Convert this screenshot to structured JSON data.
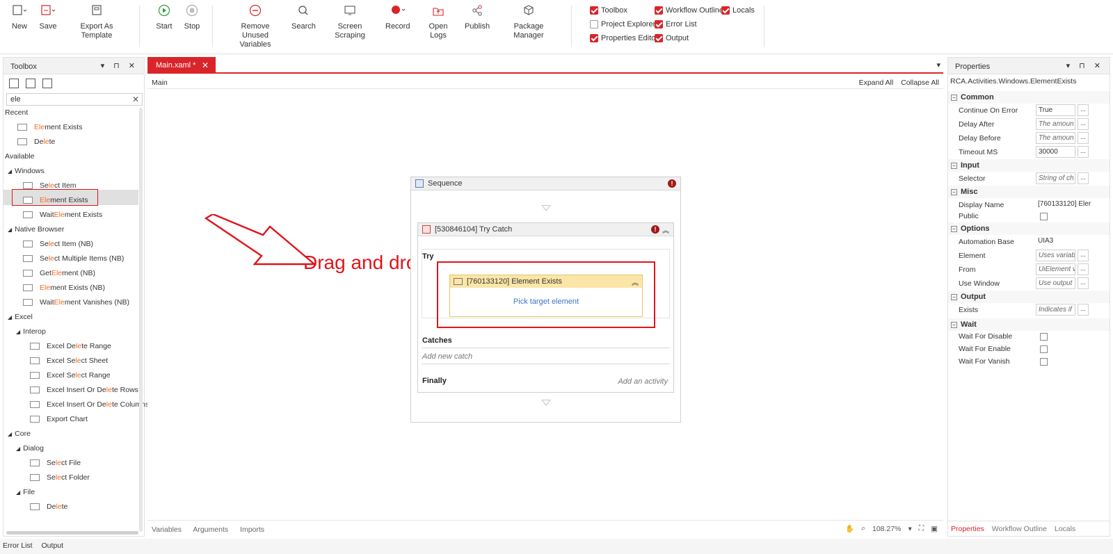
{
  "ribbon": {
    "buttons": {
      "new": "New",
      "save": "Save",
      "export": "Export As Template",
      "start": "Start",
      "stop": "Stop",
      "remove_unused_1": "Remove Unused",
      "remove_unused_2": "Variables",
      "search": "Search",
      "screen_scraping": "Screen Scraping",
      "record": "Record",
      "open_logs": "Open Logs",
      "publish": "Publish",
      "package_manager": "Package Manager"
    },
    "checks": {
      "toolbox": "Toolbox",
      "project_explorer": "Project Explorer",
      "properties_editor": "Properties Editor",
      "workflow_outline": "Workflow Outline",
      "error_list": "Error List",
      "output": "Output",
      "locals": "Locals"
    },
    "accent": "#d9252a"
  },
  "toolbox": {
    "title": "Toolbox",
    "search": "ele",
    "recent": "Recent",
    "recent_items": [
      {
        "pre": "",
        "hl": "Ele",
        "post": "ment Exists"
      },
      {
        "pre": "De",
        "hl": "le",
        "post": "te"
      }
    ],
    "available": "Available",
    "windows": "Windows",
    "windows_items": [
      {
        "pre": "Se",
        "hl": "le",
        "post": "ct Item"
      },
      {
        "pre": "",
        "hl": "Ele",
        "post": "ment Exists"
      },
      {
        "pre": "Wait ",
        "hl": "Ele",
        "post": "ment Exists"
      }
    ],
    "native_browser": "Native Browser",
    "nb_items": [
      {
        "pre": "Se",
        "hl": "le",
        "post": "ct Item (NB)"
      },
      {
        "pre": "Se",
        "hl": "le",
        "post": "ct Multiple Items (NB)"
      },
      {
        "pre": "Get ",
        "hl": "Ele",
        "post": "ment (NB)"
      },
      {
        "pre": "",
        "hl": "Ele",
        "post": "ment Exists (NB)"
      },
      {
        "pre": "Wait ",
        "hl": "Ele",
        "post": "ment Vanishes (NB)"
      }
    ],
    "excel": "Excel",
    "interop": "Interop",
    "excel_items": [
      {
        "pre": "Excel De",
        "hl": "le",
        "post": "te Range"
      },
      {
        "pre": "Excel Se",
        "hl": "le",
        "post": "ct Sheet"
      },
      {
        "pre": "Excel Se",
        "hl": "le",
        "post": "ct Range"
      },
      {
        "pre": "Excel Insert Or De",
        "hl": "le",
        "post": "te Rows"
      },
      {
        "pre": "Excel Insert Or De",
        "hl": "le",
        "post": "te Columns"
      },
      {
        "pre": "Export Chart",
        "hl": "",
        "post": ""
      }
    ],
    "core": "Core",
    "dialog": "Dialog",
    "dialog_items": [
      {
        "pre": "Se",
        "hl": "le",
        "post": "ct File"
      },
      {
        "pre": "Se",
        "hl": "le",
        "post": "ct Folder"
      }
    ],
    "file": "File",
    "file_items": [
      {
        "pre": "De",
        "hl": "le",
        "post": "te"
      }
    ]
  },
  "designer": {
    "tab": "Main.xaml *",
    "breadcrumb": "Main",
    "expand_all": "Expand All",
    "collapse_all": "Collapse All",
    "sequence": "Sequence",
    "try_catch": "[530846104] Try Catch",
    "try": "Try",
    "element_exists": "[760133120] Element Exists",
    "pick_target": "Pick target element",
    "catches": "Catches",
    "add_new_catch": "Add new catch",
    "finally": "Finally",
    "add_activity": "Add an activity",
    "annotation": "Drag and drop",
    "footer_variables": "Variables",
    "footer_arguments": "Arguments",
    "footer_imports": "Imports",
    "zoom": "108.27%"
  },
  "properties": {
    "title": "Properties",
    "subtitle": "RCA.Activities.Windows.ElementExists",
    "cat_common": "Common",
    "continue_on_error": "Continue On Error",
    "continue_on_error_val": "True",
    "delay_after": "Delay After",
    "delay_after_val": "The amoun",
    "delay_before": "Delay Before",
    "delay_before_val": "The amoun",
    "timeout": "Timeout MS",
    "timeout_val": "30000",
    "cat_input": "Input",
    "selector": "Selector",
    "selector_val": "String of ch",
    "cat_misc": "Misc",
    "display_name": "Display Name",
    "display_name_val": "[760133120] Eler",
    "public": "Public",
    "cat_options": "Options",
    "automation_base": "Automation Base",
    "automation_base_val": "UIA3",
    "element": "Element",
    "element_val": "Uses variab",
    "from": "From",
    "from_val": "UiElement v",
    "use_window": "Use Window",
    "use_window_val": "Use output",
    "cat_output": "Output",
    "exists": "Exists",
    "exists_val": "Indicates if",
    "cat_wait": "Wait",
    "wait_disable": "Wait For Disable",
    "wait_enable": "Wait For Enable",
    "wait_vanish": "Wait For Vanish",
    "tab_properties": "Properties",
    "tab_outline": "Workflow Outline",
    "tab_locals": "Locals"
  },
  "bottom": {
    "error_list": "Error List",
    "output": "Output"
  }
}
